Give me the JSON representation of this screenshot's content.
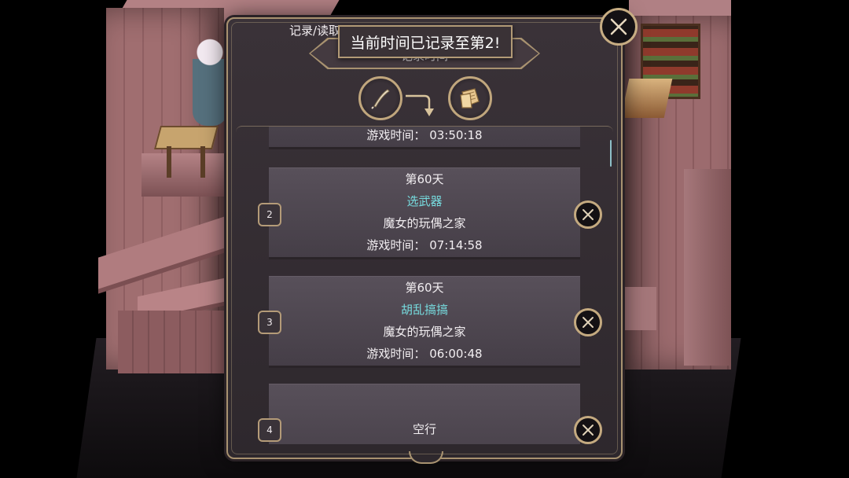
{
  "dialog": {
    "tab_label": "记录/读取",
    "header_title": "记录时间"
  },
  "toast": "当前时间已记录至第2!",
  "slots": [
    {
      "number": "",
      "day": "",
      "title": "",
      "location": "",
      "playtime": "游戏时间： 03:50:18"
    },
    {
      "number": "2",
      "day": "第60天",
      "title": "选武器",
      "location": "魔女的玩偶之家",
      "playtime": "游戏时间： 07:14:58"
    },
    {
      "number": "3",
      "day": "第60天",
      "title": "胡乱搞搞",
      "location": "魔女的玩偶之家",
      "playtime": "游戏时间： 06:00:48"
    },
    {
      "number": "4",
      "empty_label": "空行"
    }
  ],
  "icons": {
    "quill": "quill-icon",
    "paper": "paper-icon",
    "arrow": "arrow-down-right-icon",
    "close": "close-icon",
    "delete": "delete-icon"
  },
  "colors": {
    "accent_title": "#77dde0",
    "frame_gold": "#a89270",
    "panel_bg": "#2e282d"
  }
}
